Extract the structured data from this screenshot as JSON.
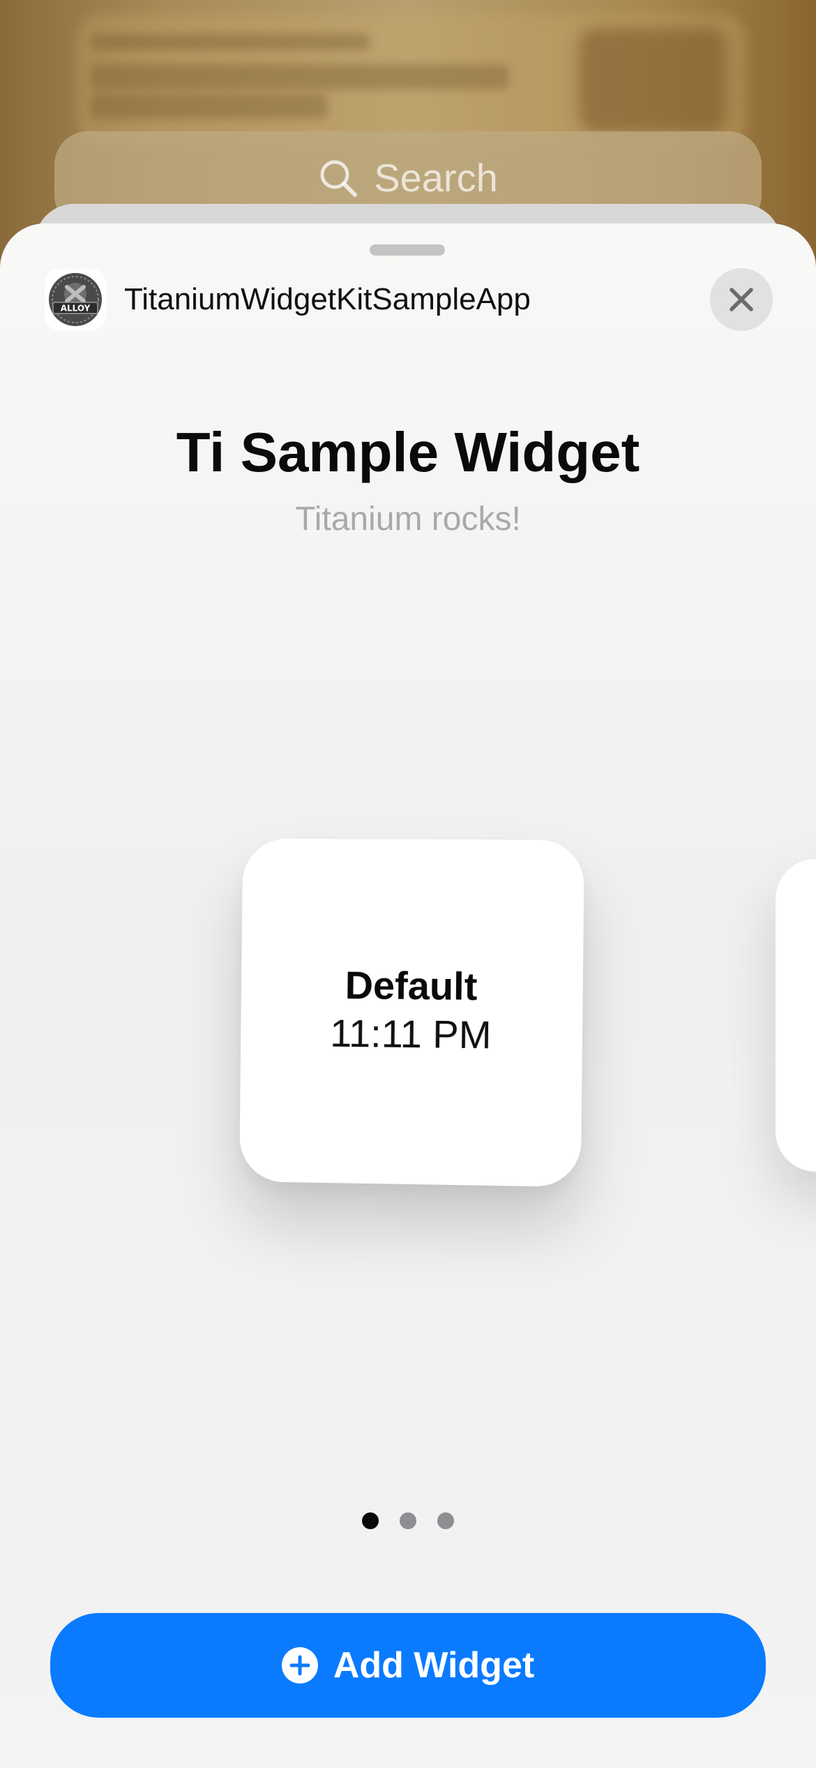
{
  "background": {
    "search_placeholder": "Search"
  },
  "header": {
    "app_name": "TitaniumWidgetKitSampleApp",
    "app_icon_text": "ALLOY"
  },
  "widget": {
    "title": "Ti Sample Widget",
    "subtitle": "Titanium rocks!",
    "preview": {
      "title": "Default",
      "time": "11:11 PM"
    }
  },
  "pagination": {
    "total": 3,
    "current": 1
  },
  "actions": {
    "add_label": "Add Widget"
  },
  "colors": {
    "accent": "#0a7bff",
    "sheet_background": "#f4f4f3"
  }
}
